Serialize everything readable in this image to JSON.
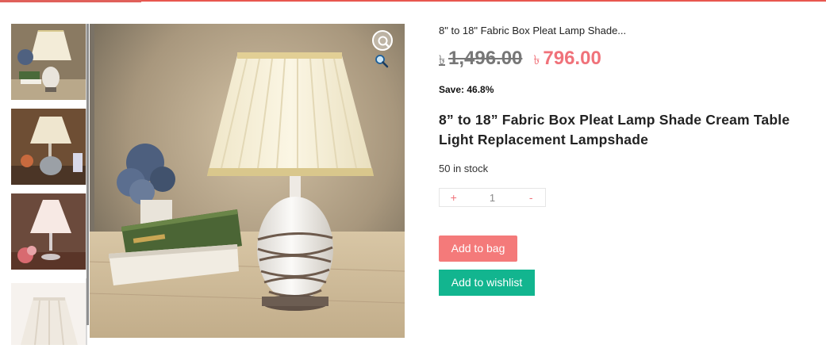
{
  "product": {
    "short_title": "8\" to 18\" Fabric Box Pleat Lamp Shade...",
    "title": "8” to 18” Fabric Box Pleat Lamp Shade Cream Table Light Replacement Lampshade",
    "currency_symbol": "৳",
    "old_price": "1,496.00",
    "new_price": "796.00",
    "save_text": "Save: 46.8%",
    "stock_text": "50 in stock"
  },
  "quantity": {
    "increment_label": "+",
    "value": "1",
    "decrement_label": "-"
  },
  "actions": {
    "add_to_bag": "Add to bag",
    "add_to_wishlist": "Add to wishlist"
  },
  "gallery": {
    "thumbnails": [
      "lamp-pleated-cream",
      "lamp-lace-shade",
      "lamp-crystal-base",
      "lampshade-only"
    ],
    "main_image": "lamp-pleated-cream",
    "zoom_icon": "search-plus-icon"
  },
  "colors": {
    "accent_red": "#f0727a",
    "bag_button": "#f47a7a",
    "wishlist_button": "#12b58f",
    "top_rule": "#e8574f"
  }
}
